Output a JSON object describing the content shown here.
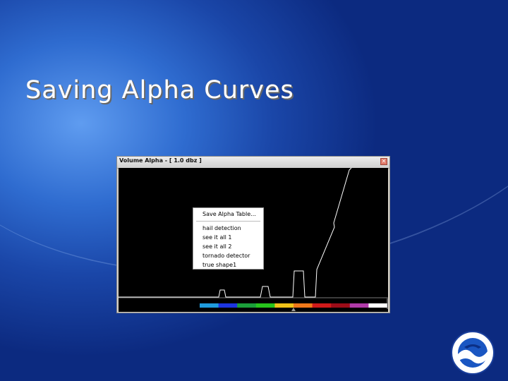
{
  "slide": {
    "title": "Saving Alpha Curves"
  },
  "window": {
    "title": "Volume Alpha - [ 1.0 dbz ]",
    "close_glyph": "✕"
  },
  "context_menu": {
    "save_label": "Save Alpha Table...",
    "items": [
      "hail detection",
      "see it all 1",
      "see it all 2",
      "tornado detector",
      "true shape1"
    ]
  },
  "colorbar": [
    "#1f9bdc",
    "#1c35e0",
    "#1b9f3a",
    "#27c41c",
    "#f0c218",
    "#f0781a",
    "#cf1a1a",
    "#9c0c18",
    "#b03aa8",
    "#ffffff"
  ],
  "icons": {
    "close": "close-icon",
    "logo": "noaa-logo-icon"
  }
}
